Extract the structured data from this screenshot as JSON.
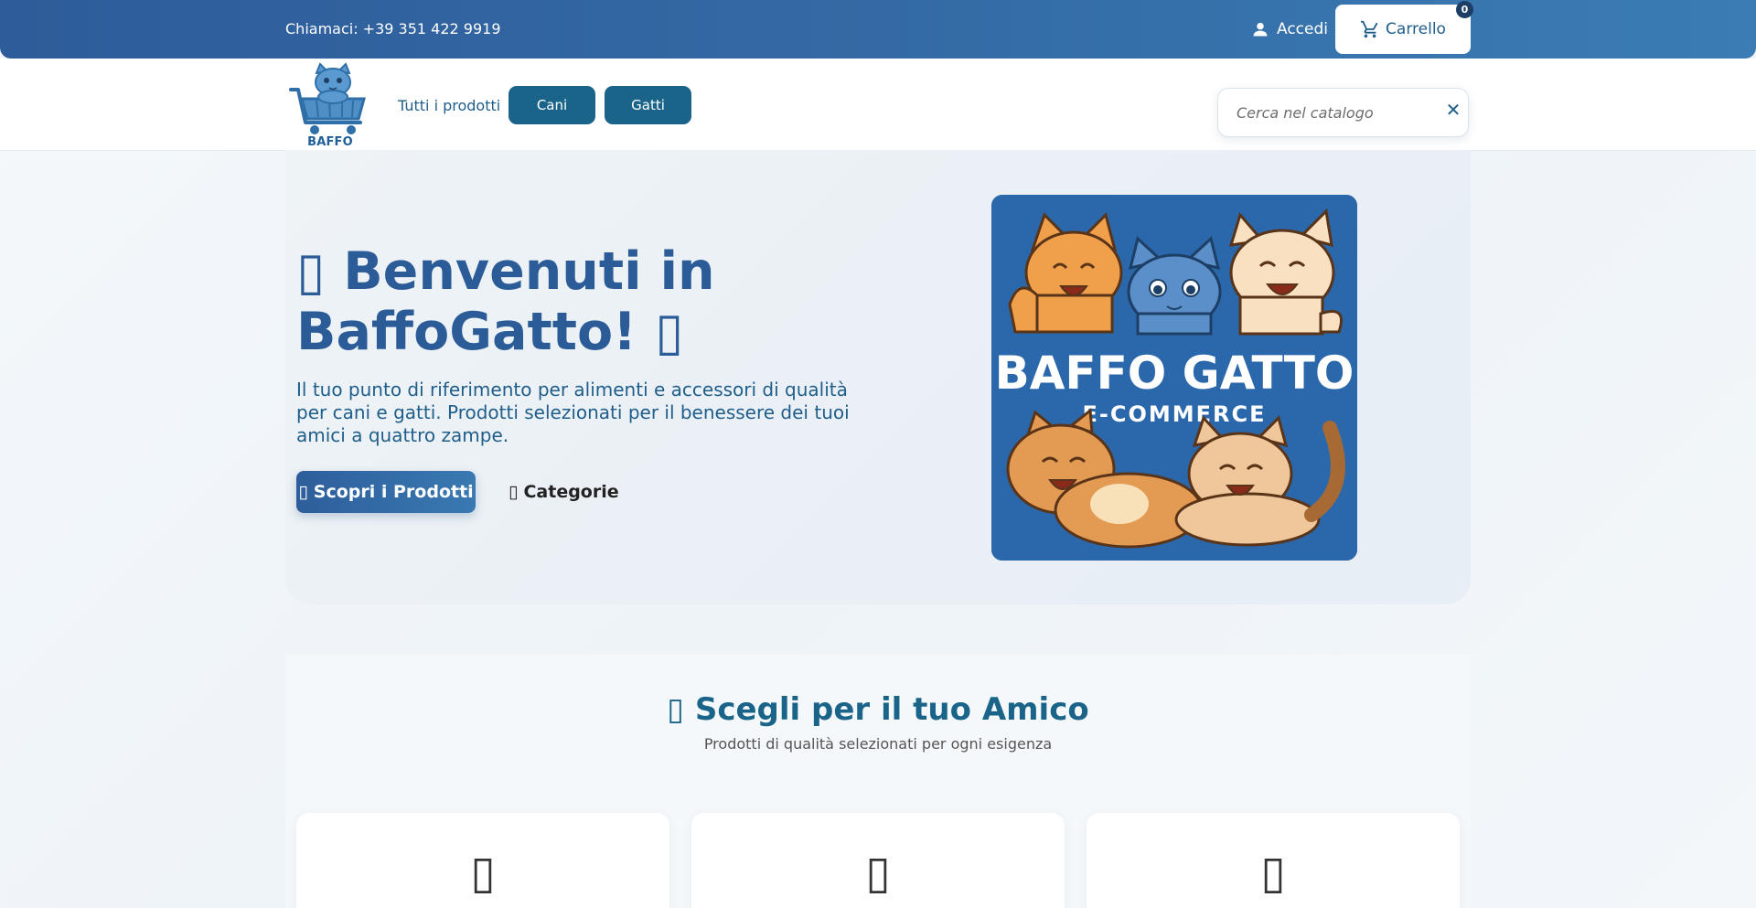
{
  "topbar": {
    "phone_text": "Chiamaci: +39 351 422 9919",
    "login_label": "Accedi",
    "login_icon": "person-icon",
    "cart_label": "Carrello",
    "cart_icon": "cart-icon",
    "cart_count": "0"
  },
  "nav": {
    "logo_text": "BAFFO GATTO",
    "all_products": "Tutti i prodotti",
    "pills": [
      "Cani",
      "Gatti"
    ]
  },
  "search": {
    "placeholder": "Cerca nel catalogo",
    "clear_symbol": "✕"
  },
  "hero": {
    "title_glyph_left": "▯",
    "title": "Benvenuti in BaffoGatto!",
    "title_glyph_right": "▯",
    "subtitle": "Il tuo punto di riferimento per alimenti e accessori di qualità per cani e gatti. Prodotti selezionati per il benessere dei tuoi amici a quattro zampe.",
    "primary_glyph": "▯",
    "primary_label": "Scopri i Prodotti",
    "secondary_glyph": "▯",
    "secondary_label": "Categorie",
    "image_title": "BAFFO GATTO",
    "image_subtitle": "E-COMMERCE"
  },
  "section": {
    "title_glyph": "▯",
    "title": "Scegli per il tuo Amico",
    "subtitle": "Prodotti di qualità selezionati per ogni esigenza",
    "card_glyphs": [
      "▯",
      "▯",
      "▯"
    ]
  },
  "colors": {
    "topbar": "#336aa5",
    "accent": "#1a6489",
    "hero_title": "#2b5c98",
    "hero_image_bg": "#2b68ab"
  }
}
